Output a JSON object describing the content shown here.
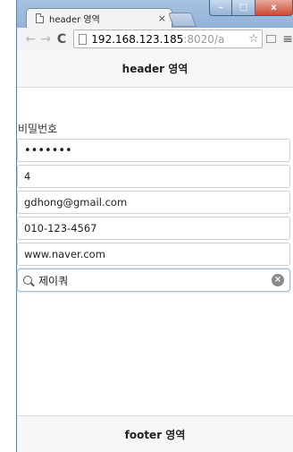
{
  "browser": {
    "tab_title": "header 영역",
    "tab_close": "×",
    "url_host": "192.168.123.185",
    "url_rest": ":8020/a",
    "caption": {
      "minimize": "–",
      "maximize": "□",
      "close": "x"
    },
    "icons": {
      "back": "←",
      "forward": "→",
      "reload": "C",
      "star": "☆",
      "menu": "≡"
    }
  },
  "page": {
    "header_text": "header 영역",
    "footer_text": "footer 영역",
    "password_label": "비밀번호",
    "fields": [
      {
        "name": "password",
        "value": "•••••••"
      },
      {
        "name": "number",
        "value": "4"
      },
      {
        "name": "email",
        "value": "gdhong@gmail.com"
      },
      {
        "name": "phone",
        "value": "010-123-4567"
      },
      {
        "name": "url",
        "value": "www.naver.com"
      }
    ],
    "search": {
      "value": "제이쿼",
      "clear": "×"
    }
  }
}
